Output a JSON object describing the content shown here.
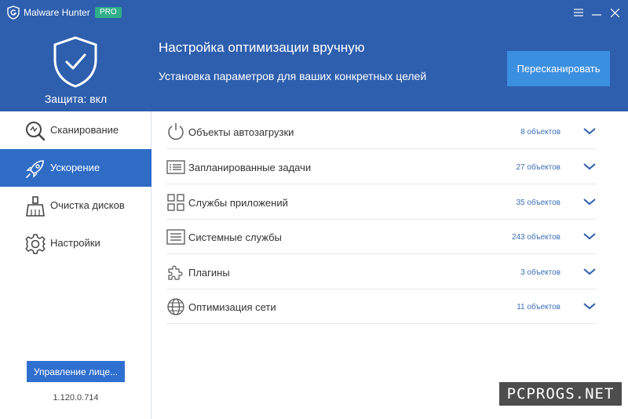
{
  "app": {
    "title": "Malware Hunter",
    "badge": "PRO",
    "accent": "#2e5fae"
  },
  "header": {
    "protection_status": "Защита: вкл",
    "title": "Настройка оптимизации вручную",
    "subtitle": "Установка параметров для ваших конкретных целей",
    "rescan_label": "Пересканировать"
  },
  "sidebar": {
    "items": [
      {
        "label": "Сканирование",
        "icon": "scan-magnifier-icon"
      },
      {
        "label": "Ускорение",
        "icon": "rocket-icon"
      },
      {
        "label": "Очистка дисков",
        "icon": "broom-icon"
      },
      {
        "label": "Настройки",
        "icon": "gear-icon"
      }
    ],
    "active_index": 1,
    "license_label": "Управление лице...",
    "version": "1.120.0.714"
  },
  "main": {
    "rows": [
      {
        "label": "Объекты автозагрузки",
        "count": "8 объектов",
        "icon": "power-icon"
      },
      {
        "label": "Запланированные задачи",
        "count": "27 объектов",
        "icon": "task-list-icon"
      },
      {
        "label": "Службы приложений",
        "count": "35 объектов",
        "icon": "app-grid-icon"
      },
      {
        "label": "Системные службы",
        "count": "243 объектов",
        "icon": "system-list-icon"
      },
      {
        "label": "Плагины",
        "count": "3 объектов",
        "icon": "puzzle-icon"
      },
      {
        "label": "Оптимизация сети",
        "count": "11 объектов",
        "icon": "globe-icon"
      }
    ]
  },
  "watermark": "PCPROGS.NET"
}
